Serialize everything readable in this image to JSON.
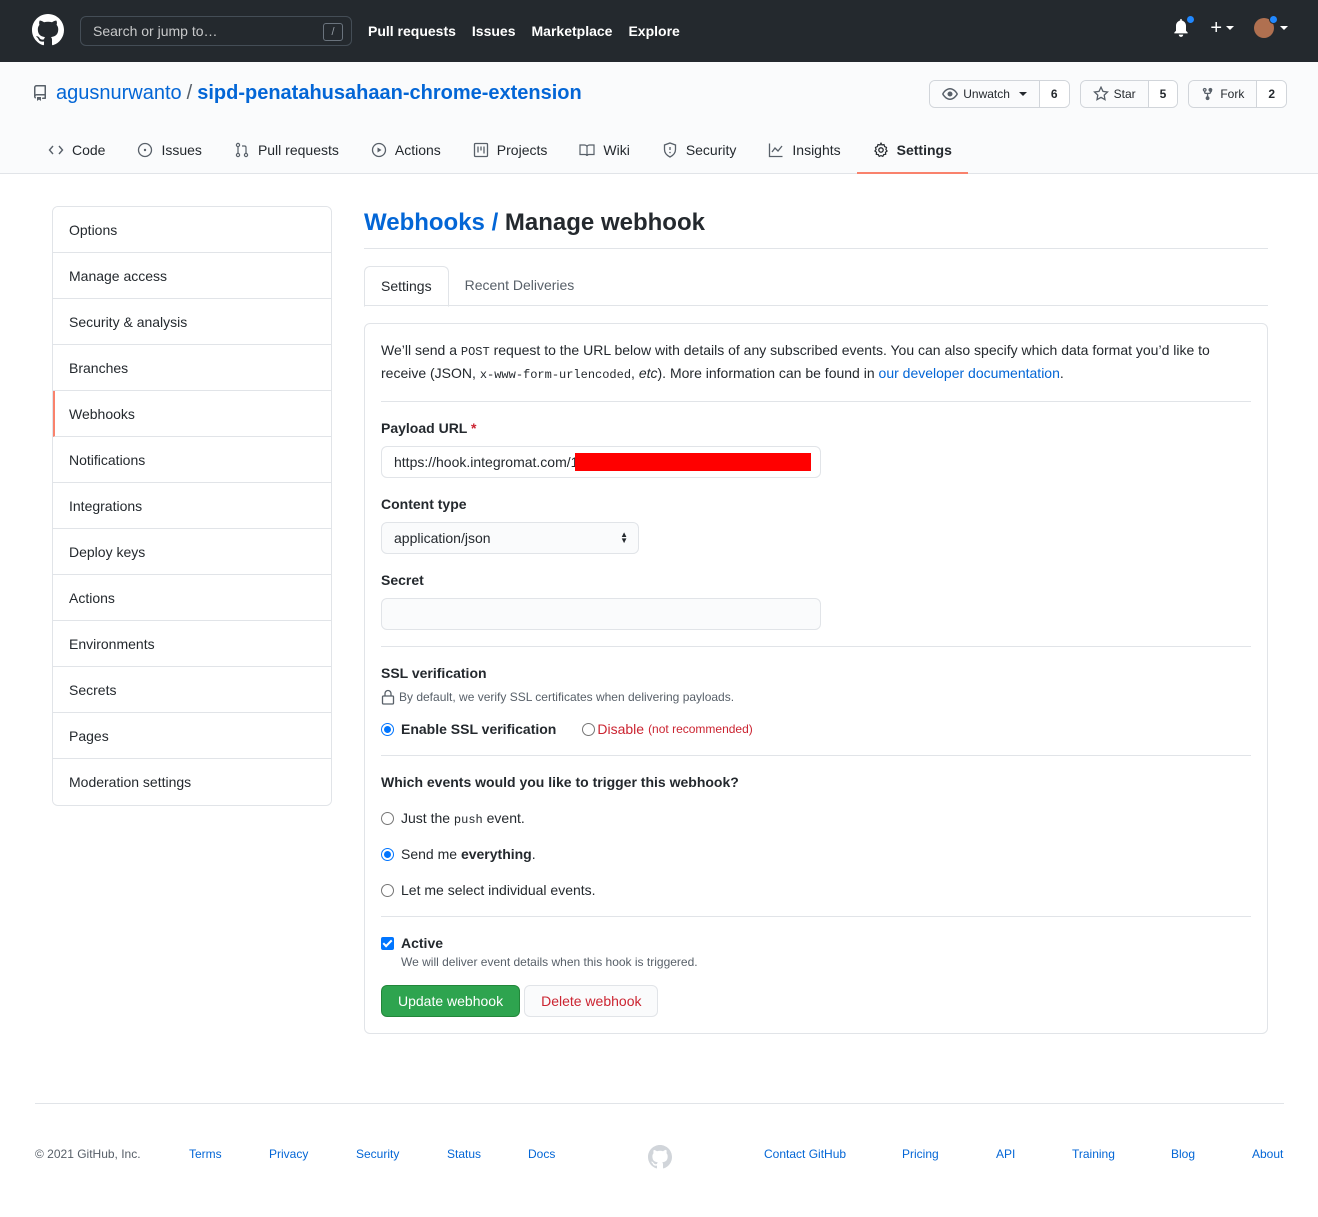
{
  "header": {
    "search_placeholder": "Search or jump to…",
    "search_shortcut": "/",
    "nav": [
      "Pull requests",
      "Issues",
      "Marketplace",
      "Explore"
    ],
    "plus": "+"
  },
  "repo": {
    "owner": "agusnurwanto",
    "separator": "/",
    "name": "sipd-penatahusahaan-chrome-extension",
    "watch_label": "Unwatch",
    "watch_count": "6",
    "star_label": "Star",
    "star_count": "5",
    "fork_label": "Fork",
    "fork_count": "2",
    "tabs": [
      "Code",
      "Issues",
      "Pull requests",
      "Actions",
      "Projects",
      "Wiki",
      "Security",
      "Insights",
      "Settings"
    ]
  },
  "sidebar": {
    "items": [
      "Options",
      "Manage access",
      "Security & analysis",
      "Branches",
      "Webhooks",
      "Notifications",
      "Integrations",
      "Deploy keys",
      "Actions",
      "Environments",
      "Secrets",
      "Pages",
      "Moderation settings"
    ]
  },
  "main": {
    "crumb": "Webhooks /",
    "title": "Manage webhook",
    "tabs": [
      "Settings",
      "Recent Deliveries"
    ],
    "intro": {
      "p1": "We’ll send a ",
      "code1": "POST",
      "p2": " request to the URL below with details of any subscribed events. You can also specify which data format you’d like to receive (JSON, ",
      "code2": "x-www-form-urlencoded",
      "p3": ", ",
      "etc": "etc",
      "p4": "). More information can be found in ",
      "link": "our developer documentation",
      "p5": "."
    },
    "payload_label": "Payload URL",
    "required_mark": "*",
    "payload_value": "https://hook.integromat.com/1",
    "content_type_label": "Content type",
    "content_type_value": "application/json",
    "secret_label": "Secret",
    "secret_value": "",
    "ssl_label": "SSL verification",
    "ssl_note": "By default, we verify SSL certificates when delivering payloads.",
    "ssl_enable": "Enable SSL verification",
    "ssl_disable": "Disable",
    "ssl_not_recommended": "(not recommended)",
    "events_label": "Which events would you like to trigger this webhook?",
    "event_push_a": "Just the ",
    "event_push_code": "push",
    "event_push_b": " event.",
    "event_all_a": "Send me ",
    "event_all_b": "everything",
    "event_all_c": ".",
    "event_select": "Let me select individual events.",
    "active_label": "Active",
    "active_note": "We will deliver event details when this hook is triggered.",
    "update_button": "Update webhook",
    "delete_button": "Delete webhook"
  },
  "footer": {
    "copyright": "© 2021 GitHub, Inc.",
    "links_left": [
      "Terms",
      "Privacy",
      "Security",
      "Status",
      "Docs"
    ],
    "links_right": [
      "Contact GitHub",
      "Pricing",
      "API",
      "Training",
      "Blog",
      "About"
    ]
  },
  "colors": {
    "header_bg": "#24292e",
    "link": "#0366d6",
    "accent_tab": "#f9826c",
    "primary_button": "#2ea44f",
    "danger": "#cb2431"
  }
}
